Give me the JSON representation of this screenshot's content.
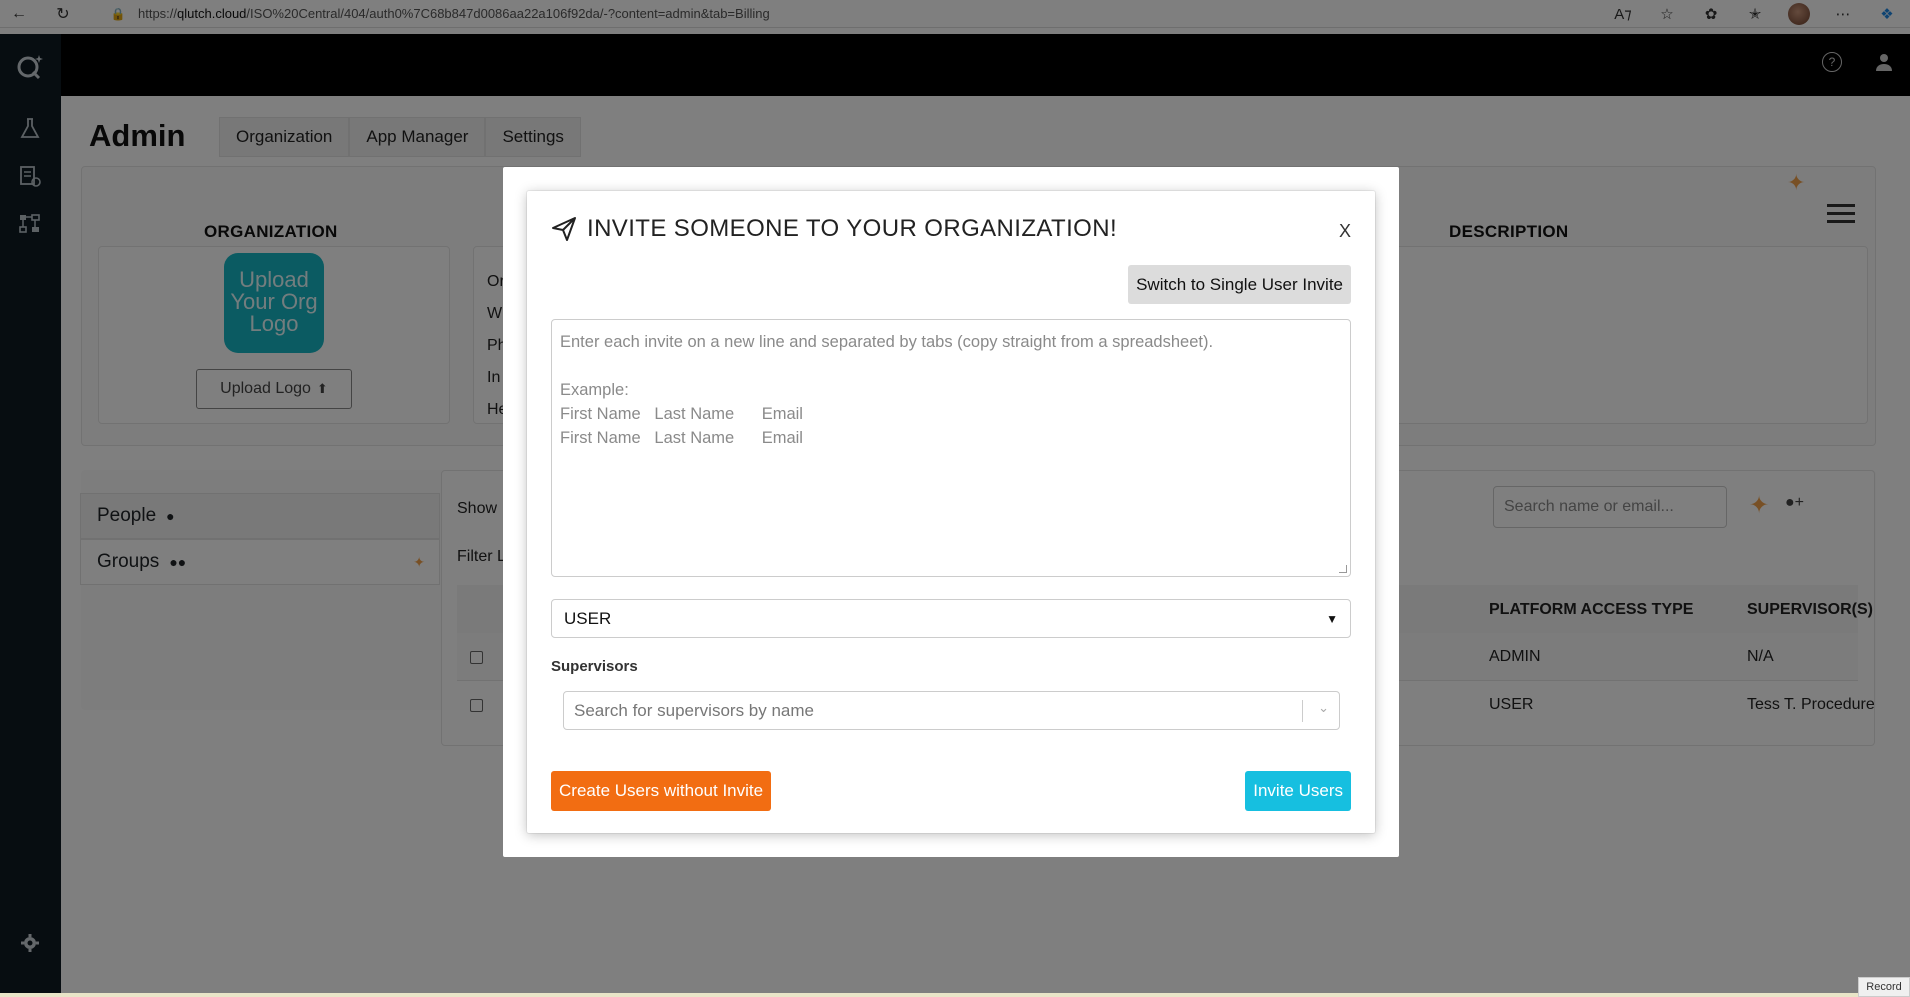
{
  "browser": {
    "url_prefix": "https://",
    "url_host": "qlutch.cloud",
    "url_path": "/ISO%20Central/404/auth0%7C68b847d0086aa22a106f92da/-?content=admin&tab=Billing"
  },
  "page": {
    "title": "Admin",
    "tabs": [
      "Organization",
      "App Manager",
      "Settings"
    ]
  },
  "org_card": {
    "heading": "ORGANIZATION",
    "logo_text": [
      "Upload",
      "Your Org",
      "Logo"
    ],
    "upload_label": "Upload Logo",
    "truncated_labels": [
      "Or",
      "W",
      "Ph",
      "In",
      "He"
    ]
  },
  "description_heading": "DESCRIPTION",
  "people_panel": {
    "items": [
      {
        "label": "People"
      },
      {
        "label": "Groups"
      }
    ]
  },
  "table_area": {
    "show_label": "Show",
    "filter_label": "Filter L",
    "search_placeholder": "Search name or email...",
    "columns": [
      "PLATFORM ACCESS TYPE",
      "SUPERVISOR(S)"
    ],
    "rows": [
      {
        "access": "ADMIN",
        "supervisor": "N/A"
      },
      {
        "access": "USER",
        "supervisor": "Tess T. Procedure"
      }
    ]
  },
  "modal": {
    "title": "INVITE SOMEONE TO YOUR ORGANIZATION!",
    "close_label": "X",
    "switch_label": "Switch to Single User Invite",
    "textarea_placeholder_lines": [
      "Enter each invite on a new line and separated by tabs (copy straight from a spreadsheet).",
      "",
      "Example:",
      "First Name   Last Name      Email",
      "First Name   Last Name      Email"
    ],
    "role_value": "USER",
    "supervisors_label": "Supervisors",
    "supervisors_placeholder": "Search for supervisors by name",
    "create_label": "Create Users without Invite",
    "invite_label": "Invite Users"
  },
  "record_label": "Record",
  "colors": {
    "sidebar": "#0e1a23",
    "topbar": "#000000",
    "create_btn": "#f26d12",
    "invite_btn": "#16bfe0",
    "logo_tile": "#17b6c4"
  }
}
